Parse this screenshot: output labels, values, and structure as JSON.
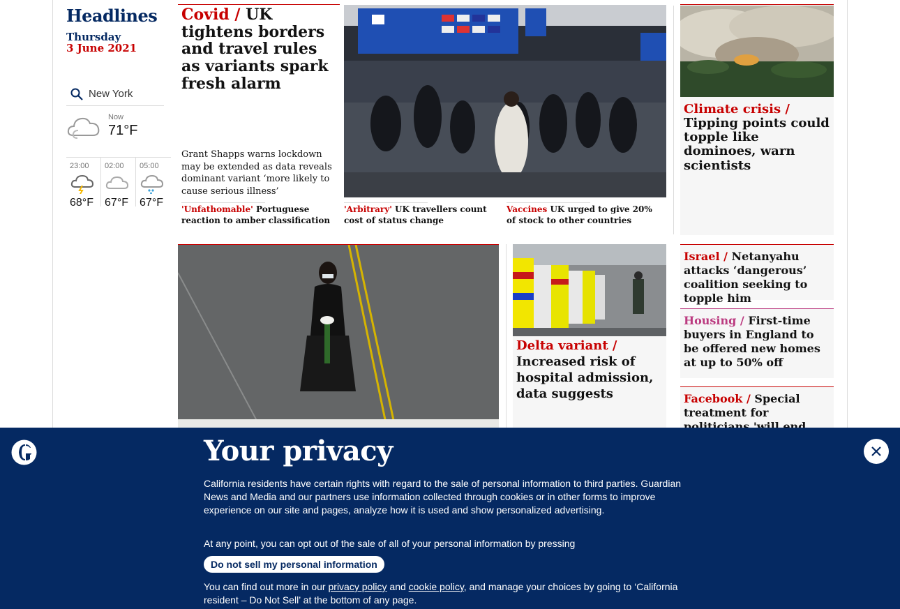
{
  "left": {
    "title": "Headlines",
    "day": "Thursday",
    "date": "3 June 2021",
    "weather": {
      "city": "New York",
      "now_label": "Now",
      "now_temp": "71°F",
      "now_icon": "cloud-icon",
      "forecast": [
        {
          "time": "23:00",
          "temp": "68°F",
          "icon": "thunder-cloud-icon"
        },
        {
          "time": "02:00",
          "temp": "67°F",
          "icon": "cloud-icon"
        },
        {
          "time": "05:00",
          "temp": "67°F",
          "icon": "rain-cloud-icon"
        }
      ]
    }
  },
  "lead": {
    "kicker": "Covid /",
    "headline": " UK tightens borders and travel rules as variants spark fresh alarm",
    "standfirst": "Grant Shapps warns lockdown may be extended as data reveals dominant variant ‘more likely to cause serious illness’",
    "sublinks": [
      {
        "kicker": "'Unfathomable'",
        "text": " Portuguese reaction to amber classification"
      },
      {
        "kicker": "'Arbitrary'",
        "text": " UK travellers count cost of status change"
      },
      {
        "kicker": "Vaccines",
        "text": " UK urged to give 20% of stock to other countries"
      }
    ]
  },
  "climate": {
    "kicker": "Climate crisis /",
    "headline": " Tipping points could topple like dominoes, warn scientists"
  },
  "side": [
    {
      "kicker": "Israel /",
      "headline": " Netanyahu attacks ‘dangerous’ coalition seeking to topple him"
    },
    {
      "kicker": "Housing /",
      "headline": " First-time buyers in England to be offered new homes at up to 50% off"
    },
    {
      "kicker": "Facebook /",
      "headline": " Special treatment for politicians 'will end after Trump ban'"
    }
  ],
  "delta": {
    "kicker": "Delta variant /",
    "headline": " Increased risk of hospital admission, data suggests"
  },
  "privacy": {
    "title": "Your privacy",
    "p1": "California residents have certain rights with regard to the sale of personal information to third parties. Guardian News and Media and our partners use information collected through cookies or in other forms to improve experience on our site and pages, analyze how it is used and show personalized advertising.",
    "p2": "At any point, you can opt out of the sale of all of your personal information by pressing",
    "button": "Do not sell my personal information",
    "p3_a": "You can find out more in our ",
    "privacy_link": "privacy policy",
    "p3_b": " and ",
    "cookie_link": "cookie policy",
    "p3_c": ", and manage your choices by going to ‘California resident – Do Not Sell’ at the bottom of any page."
  },
  "colors": {
    "brand_blue": "#052962",
    "news_red": "#c70000",
    "lifestyle_pink": "#bb3b80"
  }
}
